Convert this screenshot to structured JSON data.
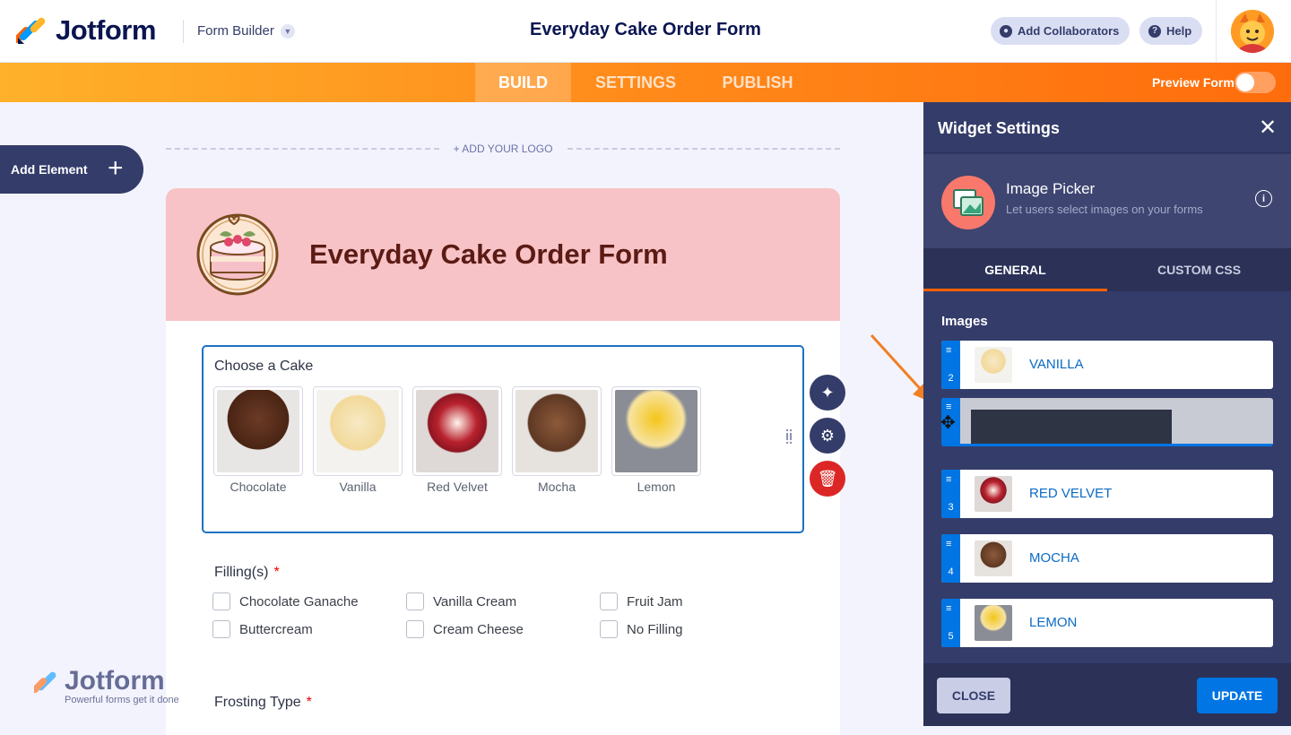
{
  "header": {
    "brand": "Jotform",
    "mode": "Form Builder",
    "title": "Everyday Cake Order Form",
    "add_collaborators": "Add Collaborators",
    "help": "Help"
  },
  "nav": {
    "tabs": [
      {
        "label": "BUILD",
        "active": true
      },
      {
        "label": "SETTINGS"
      },
      {
        "label": "PUBLISH"
      }
    ],
    "preview_form": "Preview Form"
  },
  "canvas": {
    "add_element": "Add Element",
    "add_logo": "+ ADD YOUR LOGO",
    "form_title": "Everyday Cake Order Form",
    "image_question": {
      "label": "Choose a Cake",
      "options": [
        "Chocolate",
        "Vanilla",
        "Red Velvet",
        "Mocha",
        "Lemon"
      ]
    },
    "fillings": {
      "label": "Filling(s)",
      "required_mark": "*",
      "options": [
        "Chocolate Ganache",
        "Vanilla Cream",
        "Fruit Jam",
        "Buttercream",
        "Cream Cheese",
        "No Filling"
      ]
    },
    "frosting": {
      "label": "Frosting Type",
      "required_mark": "*"
    },
    "watermark": {
      "brand": "Jotform",
      "tagline": "Powerful forms get it done"
    }
  },
  "panel": {
    "title": "Widget Settings",
    "widget_name": "Image Picker",
    "widget_desc": "Let users select images on your forms",
    "tabs": [
      "GENERAL",
      "CUSTOM CSS"
    ],
    "images_label": "Images",
    "items": [
      {
        "num": "2",
        "label": "VANILLA"
      },
      {
        "num": "3",
        "label": "RED VELVET"
      },
      {
        "num": "4",
        "label": "MOCHA"
      },
      {
        "num": "5",
        "label": "LEMON"
      }
    ],
    "close": "CLOSE",
    "update": "UPDATE"
  },
  "colors": {
    "brand_orange": "#ff6100",
    "accent_blue": "#0075e3",
    "panel_bg": "#343c6a",
    "header_pink": "#f7c3c6"
  }
}
